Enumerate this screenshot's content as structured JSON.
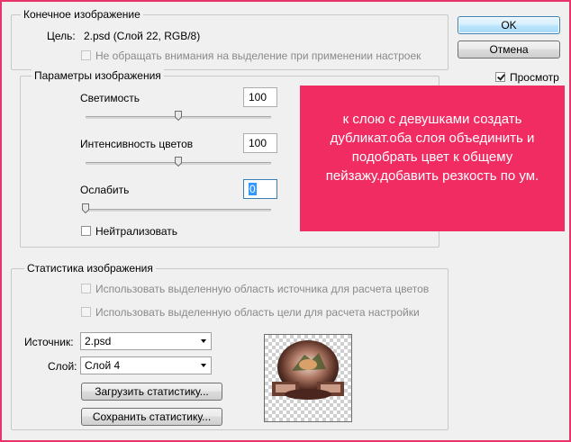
{
  "dialog": {
    "target_group": {
      "legend": "Конечное изображение",
      "target_label": "Цель:",
      "target_value": "2.psd (Слой 22, RGB/8)",
      "ignore_selection_label": "Не обращать внимания на выделение при применении настроек"
    },
    "image_options": {
      "legend": "Параметры изображения",
      "luminance_label": "Светимость",
      "luminance_value": "100",
      "color_intensity_label": "Интенсивность цветов",
      "color_intensity_value": "100",
      "fade_label": "Ослабить",
      "fade_value": "0",
      "neutralize_label": "Нейтрализовать"
    },
    "sliders": {
      "luminance": 0.5,
      "color_intensity": 0.5,
      "fade": 0
    },
    "statistics": {
      "legend": "Статистика изображения",
      "use_source_selection_label": "Использовать выделенную область источника для расчета цветов",
      "use_target_selection_label": "Использовать выделенную область цели для расчета настройки",
      "source_label": "Источник:",
      "source_value": "2.psd",
      "layer_label": "Слой:",
      "layer_value": "Слой 4",
      "load_button": "Загрузить статистику...",
      "save_button": "Сохранить статистику..."
    },
    "buttons": {
      "ok": "OK",
      "cancel": "Отмена",
      "preview_label": "Просмотр"
    },
    "states": {
      "ignore_selection_checked": false,
      "neutralize_checked": false,
      "preview_checked": true
    }
  },
  "overlay_note": "к слою с девушками создать дубликат.оба слоя объединить и подобрать цвет к общему пейзажу.добавить резкость по ум.",
  "colors": {
    "frame_border": "#e8336b",
    "overlay_background": "#f02c62",
    "default_button_border": "#3c7fb1"
  }
}
